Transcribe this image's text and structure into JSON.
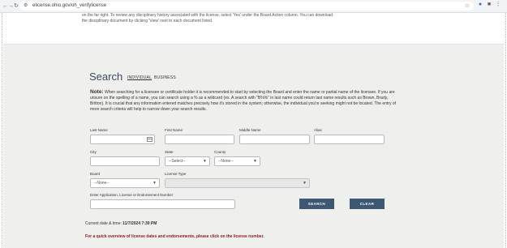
{
  "browser": {
    "url": "elicense.ohio.gov/oh_verifylicense",
    "back_icon": "arrow-left-icon",
    "forward_icon": "arrow-right-icon",
    "reload_icon": "reload-icon"
  },
  "intro_text": "on the far right. To review any disciplinary history associated with the license, select 'Yes' under the Board Action column. You can download the disciplinary document by clicking 'View' next to each document listed.",
  "search": {
    "title": "Search",
    "tabs": [
      "INDIVIDUAL",
      "BUSINESS"
    ],
    "note_label": "Note:",
    "note_text": "When searching for a licensee or certificate holder it is recommended to start by selecting the Board and enter the name or partial name of the licensee. If you are unsure on the spelling of a name, you can search using a % as a wildcard (ex. A search with \"B%%\" in last name could return last name results such as Brown, Brady, Britton). It is crucial that any information entered matches precisely how it's stored in the system; otherwise, the individual you're seeking might not be located. The entry of more search criteria will help to narrow down your search results.",
    "labels": {
      "last_name": "Last Name",
      "first_name": "First Name",
      "middle_name": "Middle Name",
      "alias": "Alias",
      "city": "City",
      "state": "State",
      "county": "County",
      "board": "Board",
      "license_type": "License Type",
      "license_number": "Enter Application, License or Endorsement Number"
    },
    "selects": {
      "state": "--Select--",
      "county": "--None--",
      "board": "--None--"
    },
    "buttons": {
      "search": "SEARCH",
      "clear": "CLEAR"
    }
  },
  "datetime_label": "Current date & time:",
  "datetime_value": "11/7/2024 7:39 PM",
  "quick_note": "For a quick overview of license dates and endorsements, please click on the license number.",
  "colors": {
    "button": "#3d5872",
    "panel": "#efefed",
    "alert_text": "#8b1a1a"
  }
}
